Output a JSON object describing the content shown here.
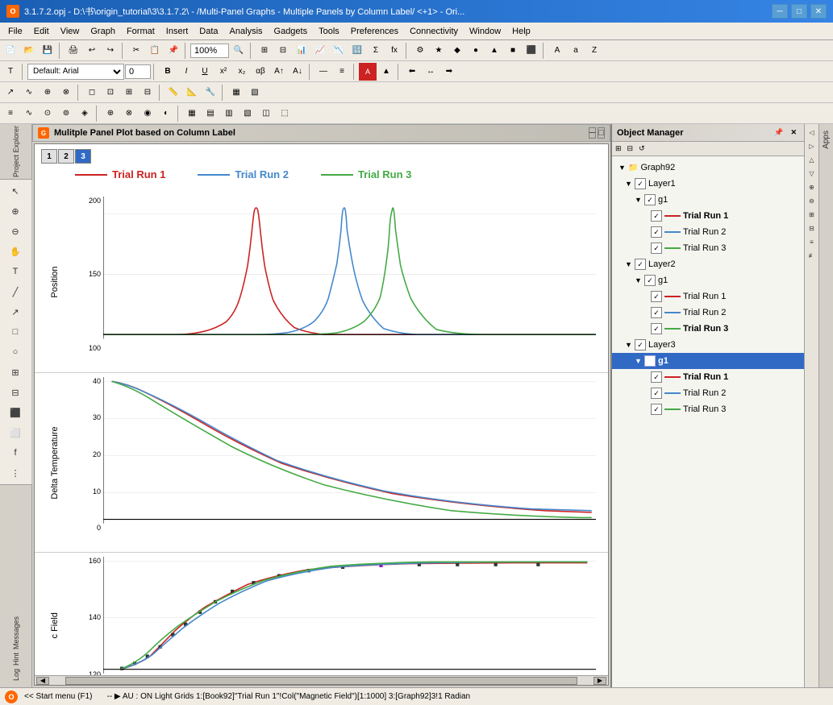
{
  "titlebar": {
    "title": "3.1.7.2.opj - D:\\书\\origin_tutorial\\3\\3.1.7.2\\ - /Multi-Panel Graphs - Multiple Panels by Column Label/ <+1> - Ori...",
    "icon_label": "O",
    "minimize": "─",
    "maximize": "□",
    "close": "✕"
  },
  "menu": {
    "items": [
      "File",
      "Edit",
      "View",
      "Graph",
      "Format",
      "Insert",
      "Data",
      "Analysis",
      "Gadgets",
      "Tools",
      "Preferences",
      "Connectivity",
      "Window",
      "Help"
    ]
  },
  "toolbar1": {
    "zoom_level": "100%",
    "font_name": "Default: Arial",
    "font_size": "0"
  },
  "graph_window": {
    "title": "Mulitple Panel Plot based on Column Label",
    "panel_tabs": [
      "1",
      "2",
      "3"
    ]
  },
  "legend": {
    "items": [
      {
        "label": "Trial Run 1",
        "color": "#cc2222"
      },
      {
        "label": "Trial Run 2",
        "color": "#4488cc"
      },
      {
        "label": "Trial Run 3",
        "color": "#44aa44"
      }
    ]
  },
  "panels": [
    {
      "y_label": "Position",
      "y_ticks": [
        "200",
        "150",
        "100"
      ],
      "type": "bell"
    },
    {
      "y_label": "Delta Temperature",
      "y_ticks": [
        "40",
        "30",
        "20",
        "10",
        "0"
      ],
      "type": "decay"
    },
    {
      "y_label": "c Field",
      "y_ticks": [
        "160",
        "140",
        "120"
      ],
      "type": "rise"
    }
  ],
  "object_manager": {
    "title": "Object Manager",
    "tree": [
      {
        "level": 0,
        "label": "Graph92",
        "type": "graph",
        "expand": true,
        "checked": null
      },
      {
        "level": 1,
        "label": "Layer1",
        "type": "layer",
        "expand": true,
        "checked": true
      },
      {
        "level": 2,
        "label": "g1",
        "type": "group",
        "expand": true,
        "checked": true
      },
      {
        "level": 3,
        "label": "Trial Run 1",
        "type": "plot",
        "color": "#cc2222",
        "bold": true,
        "checked": true
      },
      {
        "level": 3,
        "label": "Trial Run 2",
        "type": "plot",
        "color": "#4488cc",
        "bold": false,
        "checked": true
      },
      {
        "level": 3,
        "label": "Trial Run 3",
        "type": "plot",
        "color": "#44aa44",
        "bold": false,
        "checked": true
      },
      {
        "level": 1,
        "label": "Layer2",
        "type": "layer",
        "expand": true,
        "checked": true
      },
      {
        "level": 2,
        "label": "g1",
        "type": "group",
        "expand": true,
        "checked": true
      },
      {
        "level": 3,
        "label": "Trial Run 1",
        "type": "plot",
        "color": "#cc2222",
        "bold": false,
        "checked": true
      },
      {
        "level": 3,
        "label": "Trial Run 2",
        "type": "plot",
        "color": "#4488cc",
        "bold": false,
        "checked": true
      },
      {
        "level": 3,
        "label": "Trial Run 3",
        "type": "plot",
        "color": "#44aa44",
        "bold": true,
        "checked": true
      },
      {
        "level": 1,
        "label": "Layer3",
        "type": "layer",
        "expand": true,
        "checked": true,
        "selected": true
      },
      {
        "level": 2,
        "label": "g1",
        "type": "group",
        "expand": true,
        "checked": true,
        "selected": true
      },
      {
        "level": 3,
        "label": "Trial Run 1",
        "type": "plot",
        "color": "#cc2222",
        "bold": true,
        "checked": true
      },
      {
        "level": 3,
        "label": "Trial Run 2",
        "type": "plot",
        "color": "#4488cc",
        "bold": false,
        "checked": true
      },
      {
        "level": 3,
        "label": "Trial Run 3",
        "type": "plot",
        "color": "#44aa44",
        "bold": false,
        "checked": true
      }
    ]
  },
  "status_bar": {
    "start_menu": "<< Start menu (F1)",
    "status_text": "-- ▶ AU : ON Light Grids 1:[Book92]\"Trial Run 1\"!Col(\"Magnetic Field\")[1:1000]  3:[Graph92]3!1  Radian"
  }
}
